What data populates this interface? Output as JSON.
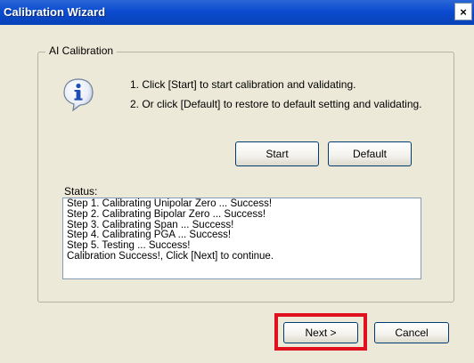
{
  "window": {
    "title": "Calibration Wizard",
    "close_label": "×"
  },
  "group": {
    "title": "AI Calibration"
  },
  "icon": "info-icon",
  "instructions": [
    "1. Click [Start] to start calibration and validating.",
    "2. Or click [Default] to restore to default setting and validating."
  ],
  "buttons": {
    "start": "Start",
    "default": "Default",
    "next": "Next >",
    "cancel": "Cancel"
  },
  "status": {
    "label": "Status:",
    "lines": [
      "Step 1. Calibrating Unipolar Zero ... Success!",
      "Step 2. Calibrating Bipolar Zero ... Success!",
      "Step 3. Calibrating Span ... Success!",
      "Step 4. Calibrating PGA ... Success!",
      "Step 5. Testing ... Success!",
      "Calibration Success!, Click [Next] to continue."
    ]
  },
  "colors": {
    "titlebar": "#0b4bd0",
    "dialog_bg": "#ece9d8",
    "highlight": "#e0101e"
  }
}
